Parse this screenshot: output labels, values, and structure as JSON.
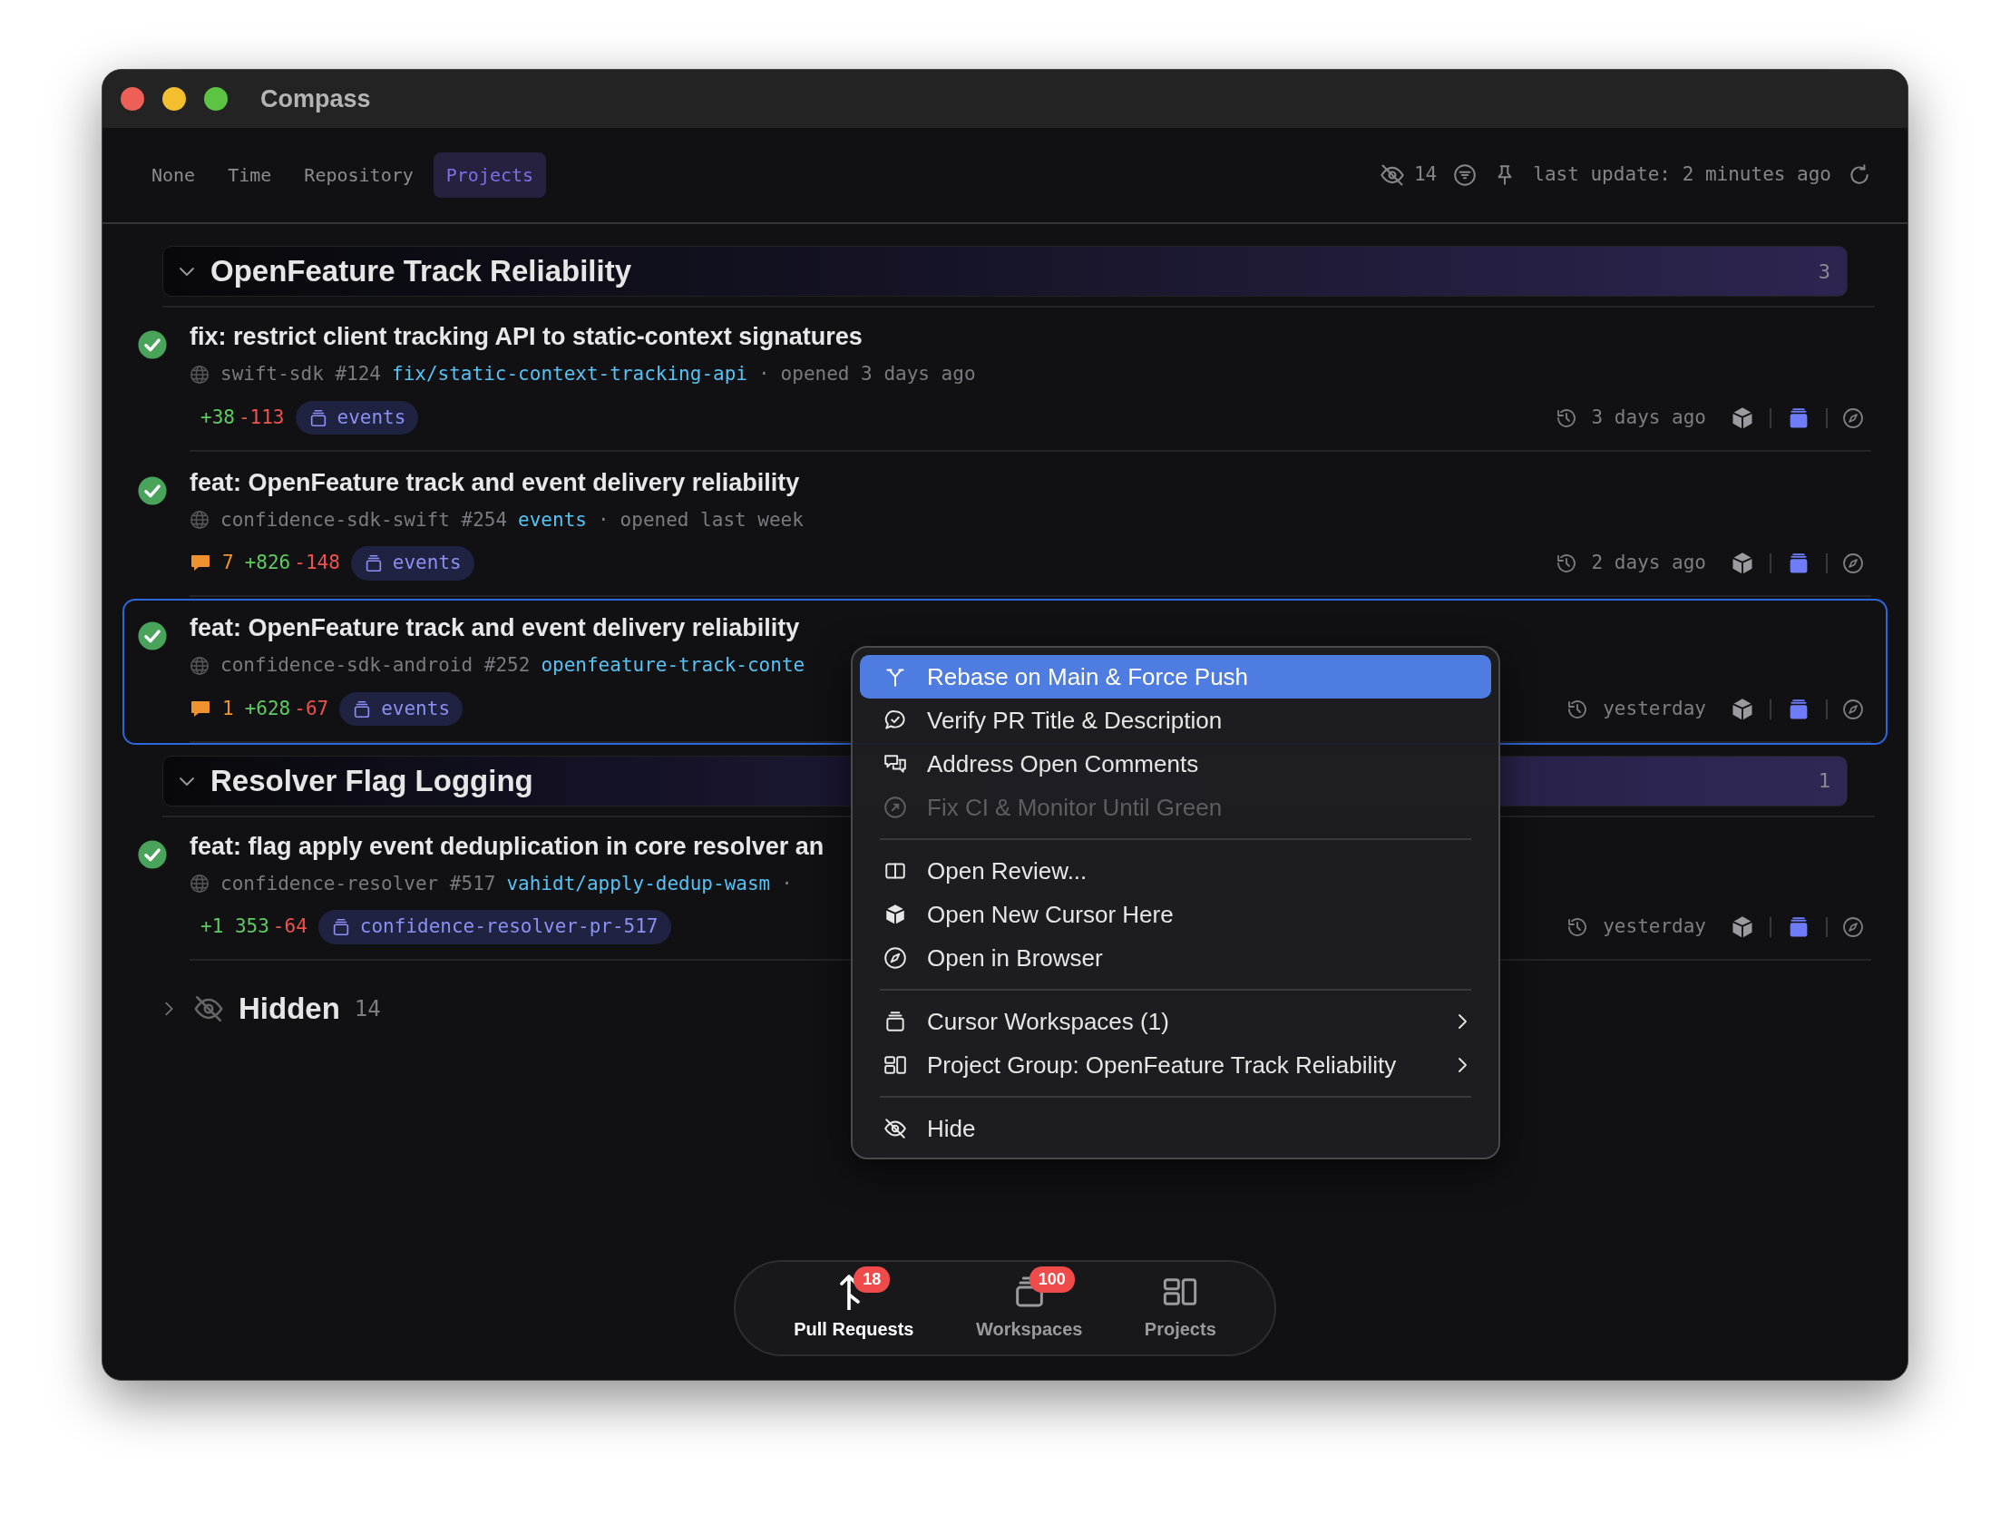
{
  "window": {
    "title": "Compass"
  },
  "grouping_tabs": [
    {
      "label": "None",
      "selected": false
    },
    {
      "label": "Time",
      "selected": false
    },
    {
      "label": "Repository",
      "selected": false
    },
    {
      "label": "Projects",
      "selected": true
    }
  ],
  "toolbar": {
    "hidden_count": "14",
    "last_update": "last update: 2 minutes ago"
  },
  "groups": [
    {
      "title": "OpenFeature Track Reliability",
      "count": "3",
      "expanded": true,
      "items": [
        {
          "title": "fix: restrict client tracking API to static-context signatures",
          "repo": "swift-sdk #124",
          "branch": "fix/static-context-tracking-api",
          "dot": "·",
          "opened": "opened 3 days ago",
          "additions": "+38",
          "deletions": "-113",
          "workspace": "events",
          "updated": "3 days ago",
          "focused": false
        },
        {
          "title": "feat: OpenFeature track and event delivery reliability",
          "repo": "confidence-sdk-swift #254",
          "branch": "events",
          "dot": "·",
          "opened": "opened last week",
          "comments": "7",
          "additions": "+826",
          "deletions": "-148",
          "workspace": "events",
          "updated": "2 days ago",
          "focused": false
        },
        {
          "title": "feat: OpenFeature track and event delivery reliability",
          "repo": "confidence-sdk-android #252",
          "branch": "openfeature-track-conte",
          "comments": "1",
          "additions": "+628",
          "deletions": "-67",
          "workspace": "events",
          "updated": "yesterday",
          "focused": true
        }
      ]
    },
    {
      "title": "Resolver Flag Logging",
      "count": "1",
      "expanded": true,
      "items": [
        {
          "title": "feat: flag apply event deduplication in core resolver an",
          "repo": "confidence-resolver #517",
          "branch": "vahidt/apply-dedup-wasm",
          "dot": "·",
          "additions": "+1 353",
          "deletions": "-64",
          "workspace": "confidence-resolver-pr-517",
          "updated": "yesterday",
          "focused": false
        }
      ]
    }
  ],
  "hidden_section": {
    "label": "Hidden",
    "count": "14",
    "expanded": false
  },
  "context_menu": {
    "items": [
      {
        "kind": "action",
        "label": "Rebase on Main & Force Push",
        "selected": true,
        "disabled": false
      },
      {
        "kind": "action",
        "label": "Verify PR Title & Description",
        "selected": false,
        "disabled": false
      },
      {
        "kind": "action",
        "label": "Address Open Comments",
        "selected": false,
        "disabled": false
      },
      {
        "kind": "action",
        "label": "Fix CI & Monitor Until Green",
        "selected": false,
        "disabled": true
      },
      {
        "kind": "separator"
      },
      {
        "kind": "action",
        "label": "Open Review...",
        "selected": false,
        "disabled": false
      },
      {
        "kind": "action",
        "label": "Open New Cursor Here",
        "selected": false,
        "disabled": false
      },
      {
        "kind": "action",
        "label": "Open in Browser",
        "selected": false,
        "disabled": false
      },
      {
        "kind": "separator"
      },
      {
        "kind": "submenu",
        "label": "Cursor Workspaces (1)",
        "selected": false,
        "disabled": false
      },
      {
        "kind": "submenu",
        "label": "Project Group: OpenFeature Track Reliability",
        "selected": false,
        "disabled": false
      },
      {
        "kind": "separator"
      },
      {
        "kind": "action",
        "label": "Hide",
        "selected": false,
        "disabled": false
      }
    ]
  },
  "bottom_nav": [
    {
      "label": "Pull Requests",
      "badge": "18",
      "selected": true
    },
    {
      "label": "Workspaces",
      "badge": "100",
      "selected": false
    },
    {
      "label": "Projects",
      "selected": false
    }
  ]
}
